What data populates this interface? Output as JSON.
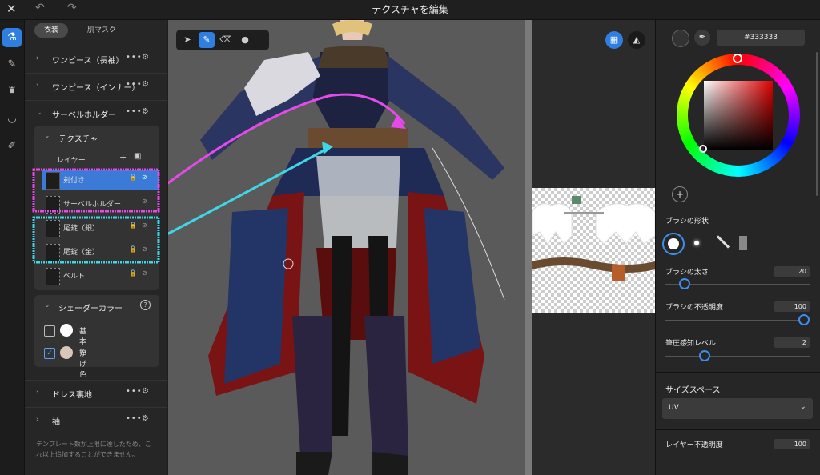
{
  "topbar": {
    "title": "テクスチャを編集"
  },
  "left_panel": {
    "tabs": [
      "衣装",
      "肌マスク"
    ],
    "sections": [
      "ワンピース（長袖）",
      "ワンピース（インナー）",
      "サーベルホルダー"
    ],
    "texture_label": "テクスチャ",
    "layers_label": "レイヤー",
    "layers": [
      "剣付き",
      "サーベルホルダー",
      "尾錠（銀）",
      "尾錠（金）",
      "ベルト"
    ],
    "shader_label": "シェーダーカラー",
    "shader_items": [
      "基本色",
      "かげ色"
    ],
    "bottom_sections": [
      "ドレス裏地",
      "袖"
    ],
    "footnote": "テンプレート数が上限に達したため、これ以上追加することができません。"
  },
  "right_panel": {
    "hex": "#333333",
    "brush_shape_label": "ブラシの形状",
    "brush_size_label": "ブラシの太さ",
    "brush_size_value": "20",
    "brush_size_fraction": 0.1,
    "brush_opacity_label": "ブラシの不透明度",
    "brush_opacity_value": "100",
    "brush_opacity_fraction": 1.0,
    "pressure_label": "筆圧感知レベル",
    "pressure_value": "2",
    "pressure_fraction": 0.25,
    "size_space_label": "サイズスペース",
    "size_space_value": "UV",
    "layer_opacity_label": "レイヤー不透明度",
    "layer_opacity_value": "100"
  },
  "colors": {
    "accent": "#2f7fe0",
    "annotation_pink": "#e44be8",
    "annotation_cyan": "#3fd6e8"
  }
}
